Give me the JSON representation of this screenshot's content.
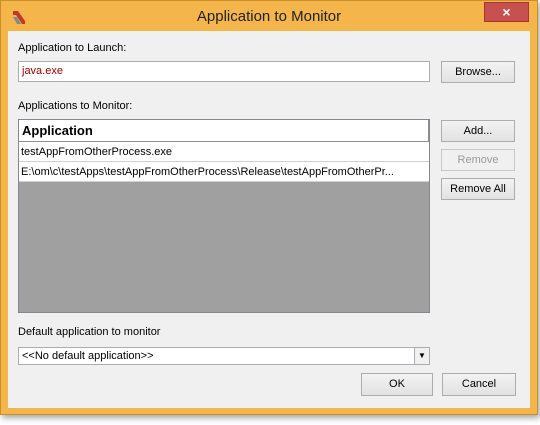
{
  "window": {
    "title": "Application to Monitor",
    "close_glyph": "×",
    "app_icon": "app-logo-icon",
    "accent": "#f4b54a",
    "close_color": "#c75050"
  },
  "launch": {
    "label": "Application to Launch:",
    "value": "java.exe",
    "value_color": "#a00000",
    "browse_label": "Browse..."
  },
  "monitor": {
    "label": "Applications to Monitor:",
    "column_header": "Application",
    "rows": [
      "testAppFromOtherProcess.exe",
      "E:\\om\\c\\testApps\\testAppFromOtherProcess\\Release\\testAppFromOtherPr..."
    ],
    "add_label": "Add...",
    "remove_label": "Remove",
    "remove_all_label": "Remove All"
  },
  "default_app": {
    "label": "Default application to monitor",
    "selected": "<<No default application>>"
  },
  "footer": {
    "ok_label": "OK",
    "cancel_label": "Cancel"
  }
}
